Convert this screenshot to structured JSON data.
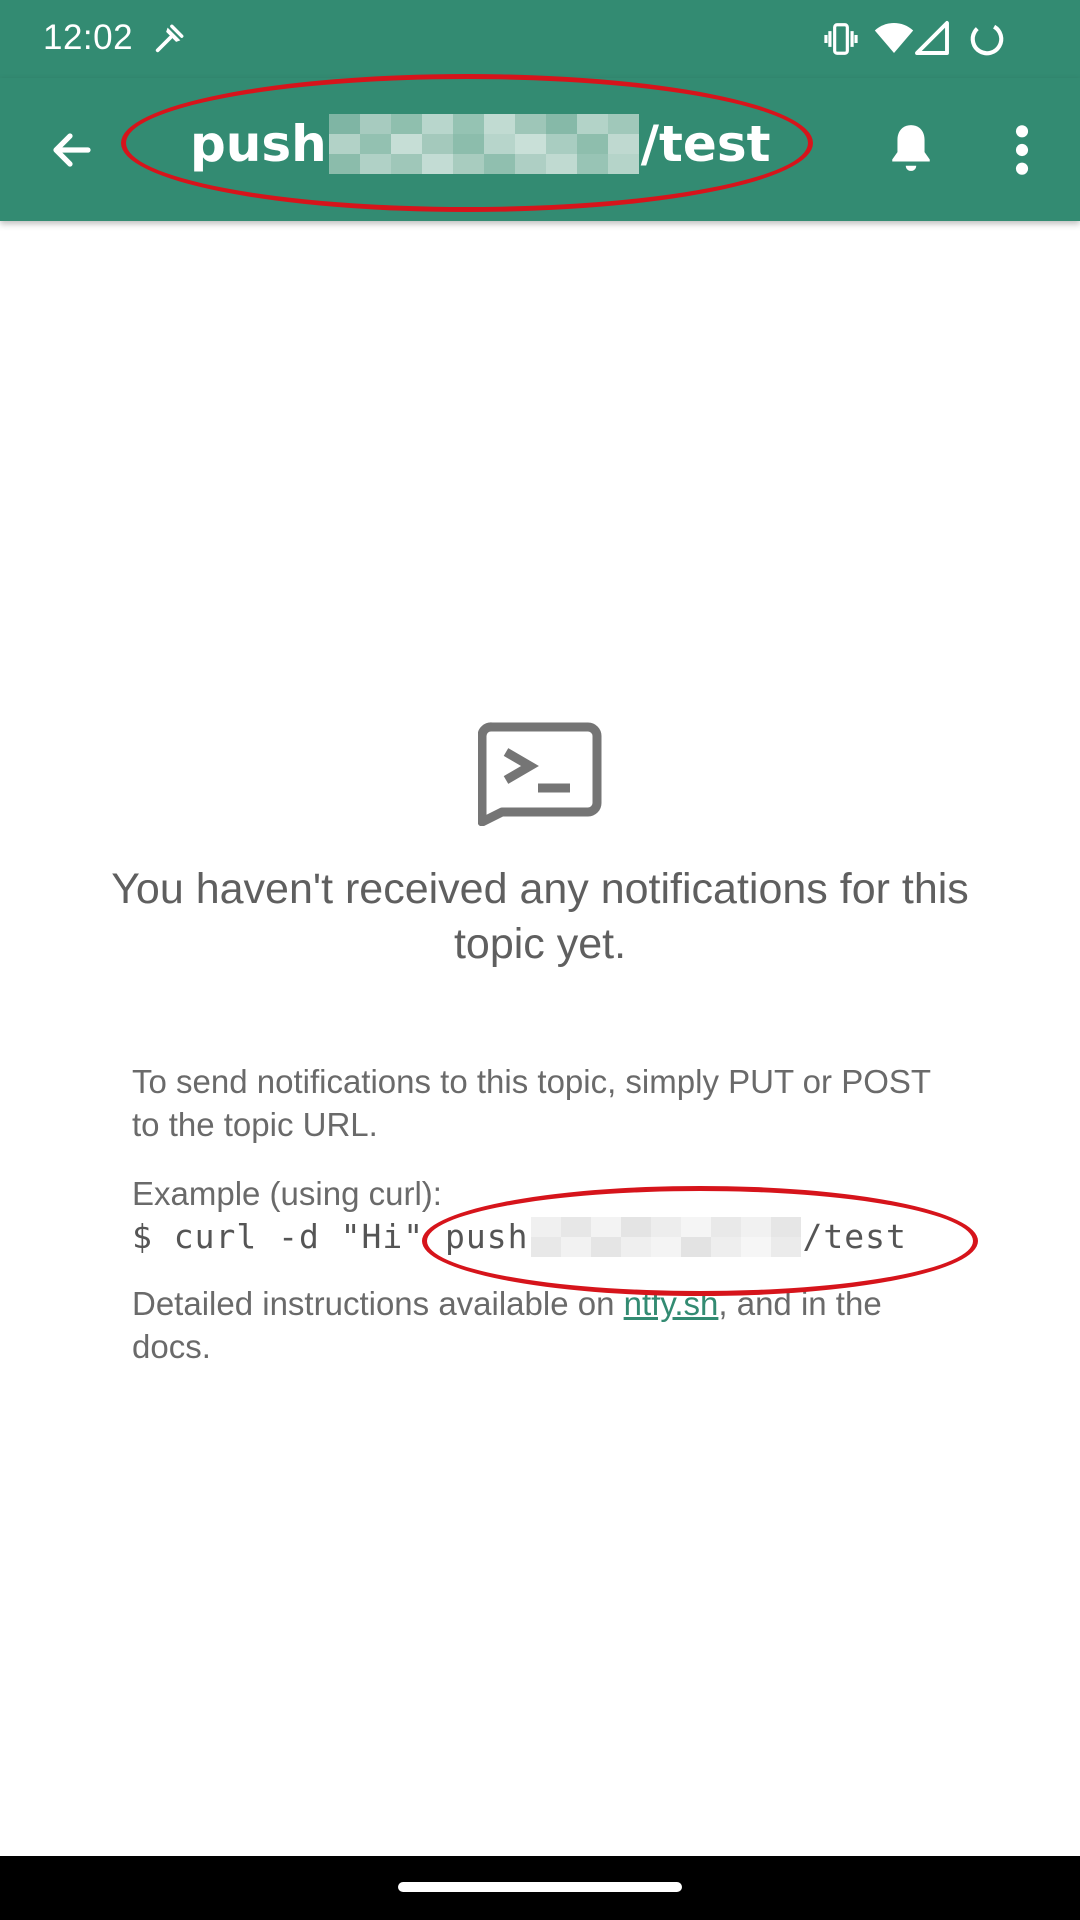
{
  "status_bar": {
    "time": "12:02"
  },
  "app_bar": {
    "title_prefix": "push",
    "title_suffix": "/test"
  },
  "empty_state": {
    "title": "You haven't received any notifications for this topic yet.",
    "instruction_1": "To send notifications to this topic, simply PUT or POST to the topic URL.",
    "example_label": "Example (using curl):",
    "example_cmd_prefix": "$ curl -d \"Hi\" push",
    "example_cmd_suffix": "/test",
    "details_prefix": "Detailed instructions available on ",
    "details_link": "ntfy.sh",
    "details_suffix": ", and in the docs."
  },
  "colors": {
    "brand": "#338b72",
    "annotation": "#d6141b"
  }
}
